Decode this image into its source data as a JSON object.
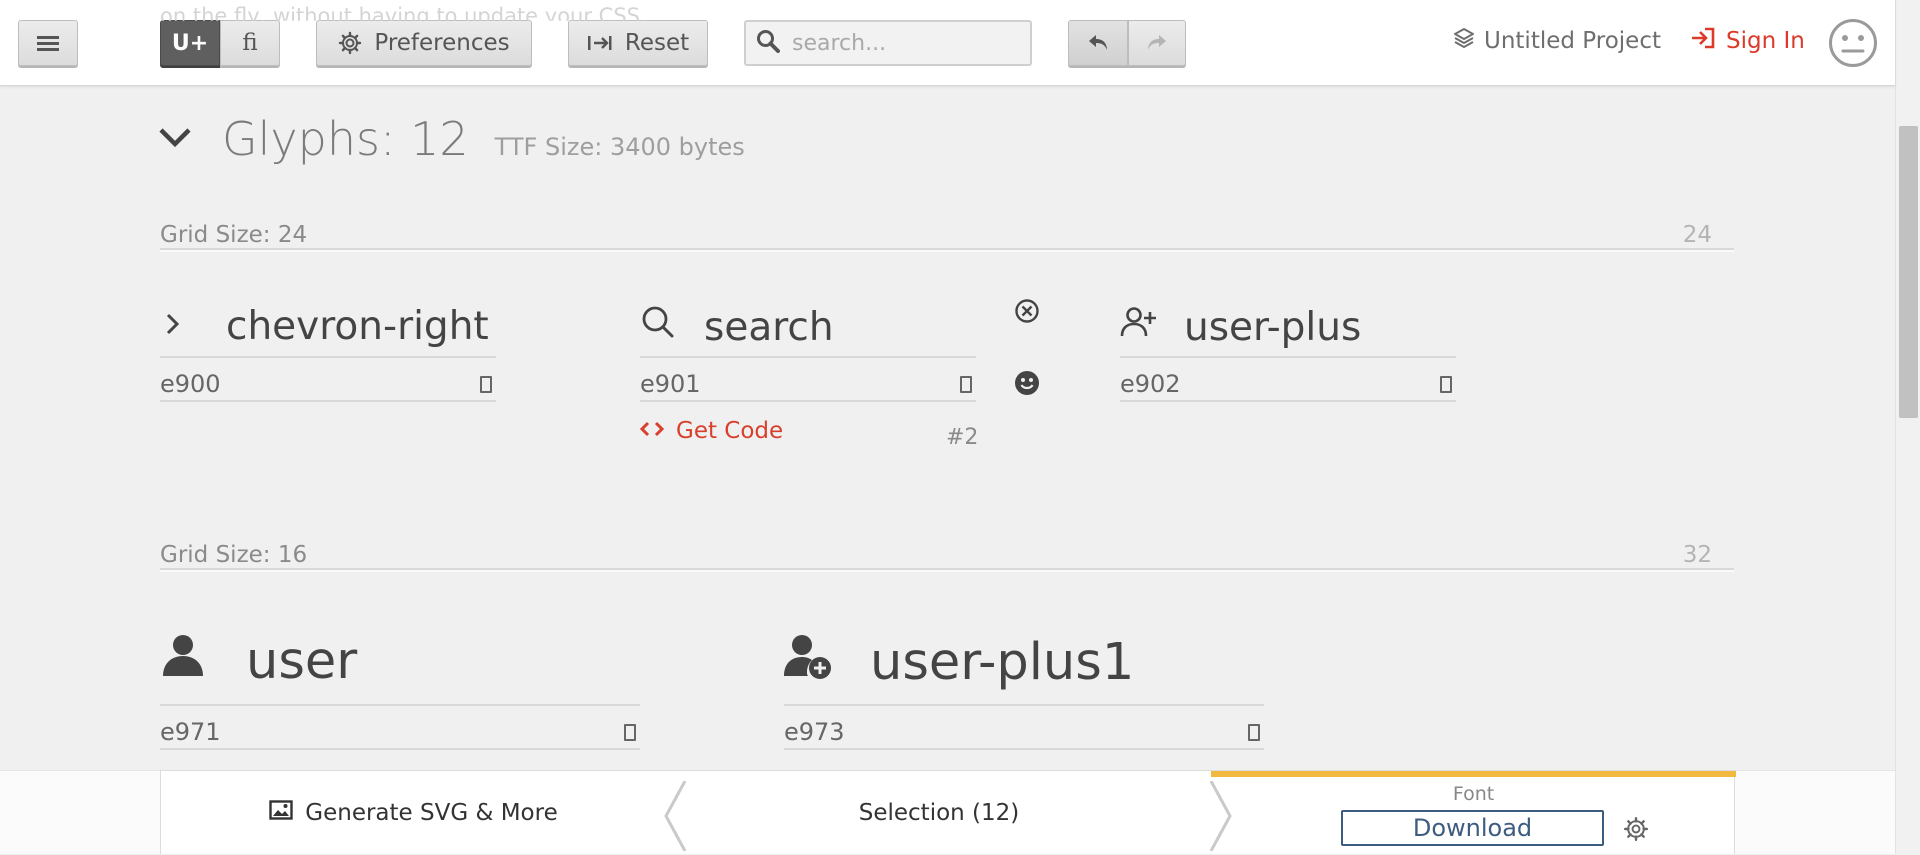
{
  "toolbar": {
    "menu_icon": "hamburger-icon",
    "unicode_toggle_label": "U+",
    "ligature_toggle_label": "ﬁ",
    "preferences_label": "Preferences",
    "reset_label": "Reset",
    "search_placeholder": "search...",
    "project_name": "Untitled Project",
    "sign_in_label": "Sign In",
    "background_text": "on the fly, without having to update your CSS."
  },
  "glyph_set": {
    "title": "Glyphs: 12",
    "ttf_size": "TTF Size: 3400 bytes"
  },
  "grids": [
    {
      "label": "Grid Size: 24",
      "right_value": "24",
      "glyphs": [
        {
          "name": "chevron-right",
          "code": "e900",
          "icon": "chevron-right-icon"
        },
        {
          "name": "search",
          "code": "e901",
          "icon": "search-icon"
        },
        {
          "name": "user-plus",
          "code": "e902",
          "icon": "user-plus-icon"
        }
      ]
    },
    {
      "label": "Grid Size: 16",
      "right_value": "32",
      "glyphs": [
        {
          "name": "user",
          "code": "e971",
          "icon": "user-icon"
        },
        {
          "name": "user-plus1",
          "code": "e973",
          "icon": "user-add-icon"
        }
      ]
    }
  ],
  "glyph_actions": {
    "get_code_label": "Get Code",
    "index_label": "#2"
  },
  "bottom_bar": {
    "generate_label": "Generate SVG & More",
    "selection_label": "Selection (12)",
    "font_label": "Font",
    "download_label": "Download"
  },
  "colors": {
    "accent_red": "#dd3b2a",
    "font_tab_yellow": "#f1b940",
    "download_blue": "#3e5c7f"
  }
}
